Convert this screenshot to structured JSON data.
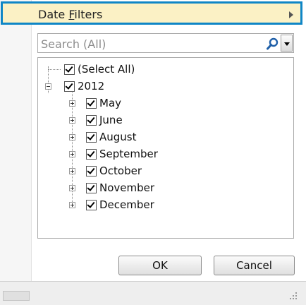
{
  "menu": {
    "date_filters_label": "Date Filters",
    "underline_letter": "F"
  },
  "search": {
    "placeholder": "Search (All)",
    "value": ""
  },
  "tree": {
    "select_all": "(Select All)",
    "year": "2012",
    "months": [
      "May",
      "June",
      "August",
      "September",
      "October",
      "November",
      "December"
    ]
  },
  "buttons": {
    "ok": "OK",
    "cancel": "Cancel"
  },
  "colors": {
    "focus_border": "#0f86c6",
    "menu_highlight": "#fbf1c5"
  },
  "icons": {
    "search": "magnifier-icon",
    "dropdown": "chevron-down-icon",
    "submenu": "chevron-right-icon",
    "resize": "resize-grip-icon"
  }
}
